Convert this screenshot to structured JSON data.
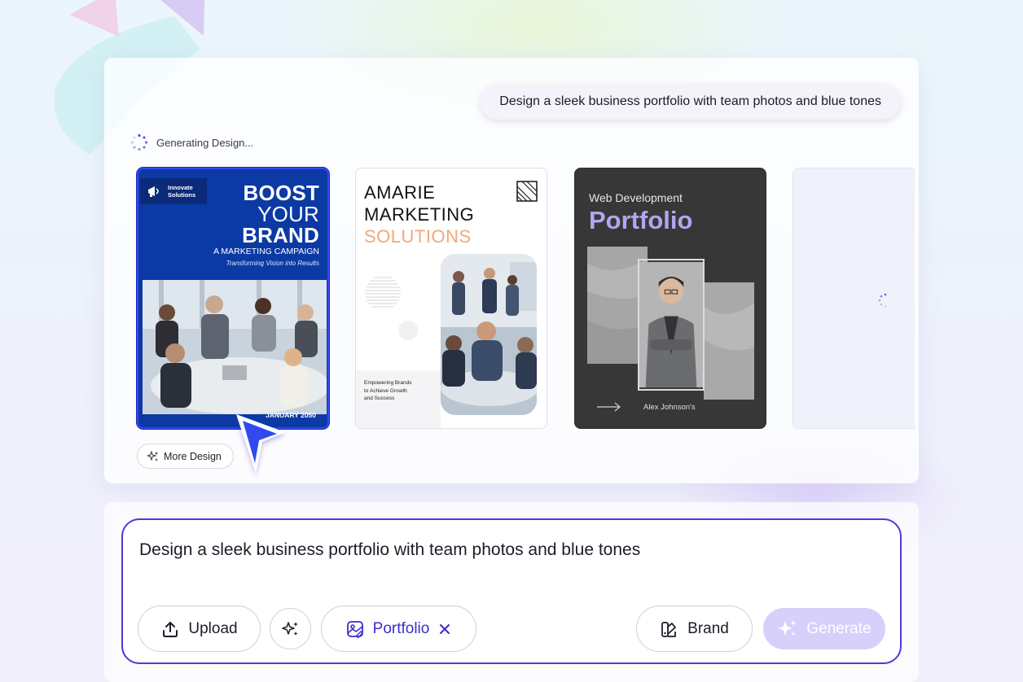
{
  "chat": {
    "user_prompt": "Design a sleek business portfolio with team photos and blue tones",
    "status_text": "Generating Design..."
  },
  "designs": [
    {
      "badge": "Innovate\nSolutions",
      "title_lines": [
        "BOOST",
        "YOUR",
        "BRAND"
      ],
      "subtitle": "A MARKETING CAMPAIGN",
      "tagline": "Transforming Vision into Results",
      "date": "JANUARY 2050",
      "selected": true
    },
    {
      "title_lines": [
        "AMARIE",
        "MARKETING",
        "SOLUTIONS"
      ],
      "tagline": "Empowering Brands\nto Achieve Growth\nand Success"
    },
    {
      "subtitle": "Web Development",
      "title": "Portfolio",
      "name": "Alex Johnson's"
    }
  ],
  "more_design_label": "More Design",
  "composer": {
    "input_value": "Design a sleek business portfolio with team photos and blue tones",
    "upload_label": "Upload",
    "portfolio_tag": "Portfolio",
    "brand_label": "Brand",
    "generate_label": "Generate",
    "accent_color": "#4e3ad8"
  }
}
